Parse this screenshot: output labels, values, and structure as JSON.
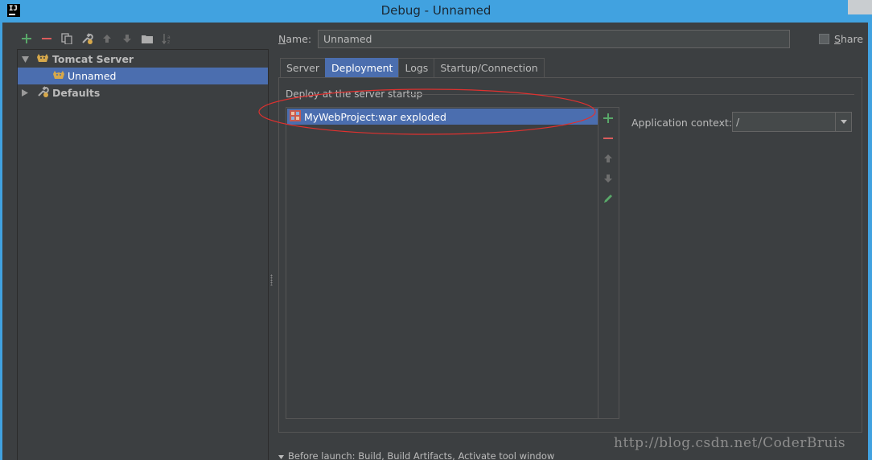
{
  "window": {
    "app_icon_text": "IJ",
    "title": "Debug - Unnamed"
  },
  "toolbar": {
    "buttons": [
      {
        "icon": "add-icon",
        "color": "#59a869"
      },
      {
        "icon": "remove-icon",
        "color": "#db5c5c"
      },
      {
        "icon": "copy-icon"
      },
      {
        "icon": "wrench-icon"
      },
      {
        "icon": "arrow-up-icon"
      },
      {
        "icon": "arrow-down-icon"
      },
      {
        "icon": "folder-icon"
      },
      {
        "icon": "sort-icon"
      }
    ]
  },
  "tree": {
    "items": [
      {
        "label": "Tomcat Server",
        "expanded": true,
        "bold": true
      },
      {
        "label": "Unnamed",
        "selected": true
      },
      {
        "label": "Defaults",
        "expanded": false,
        "bold": true
      }
    ]
  },
  "name_field": {
    "label_underlined": "N",
    "label_rest": "ame:",
    "value": "Unnamed"
  },
  "share": {
    "label_underlined": "S",
    "label_rest": "hare",
    "checked": false
  },
  "tabs": [
    {
      "label": "Server"
    },
    {
      "label": "Deployment",
      "active": true
    },
    {
      "label": "Logs"
    },
    {
      "label": "Startup/Connection"
    }
  ],
  "deployment": {
    "section_title": "Deploy at the server startup",
    "items": [
      {
        "label": "MyWebProject:war exploded",
        "selected": true
      }
    ],
    "side_buttons": [
      "add-icon",
      "remove-icon",
      "move-up-icon",
      "move-down-icon",
      "edit-icon"
    ],
    "app_context_label": "Application context:",
    "app_context_value": "/"
  },
  "before_launch": {
    "text": "Before launch: Build, Build Artifacts, Activate tool window"
  },
  "watermark": "http://blog.csdn.net/CoderBruis",
  "colors": {
    "background": "#3c3f41",
    "selection": "#4b6eaf",
    "titlebar": "#41a2e0",
    "add_green": "#59a869",
    "remove_red": "#db5c5c",
    "annotation_red": "#e0312f"
  }
}
